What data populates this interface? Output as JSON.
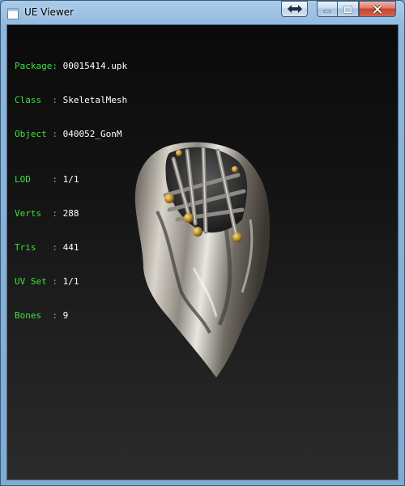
{
  "window": {
    "title": "UE Viewer",
    "icon": "app-window-icon",
    "caption_buttons": [
      "swap-arrows-icon",
      "minimize-icon",
      "maximize-icon",
      "close-icon"
    ]
  },
  "info": {
    "package": {
      "key": "Package",
      "sep": ":",
      "value": "00015414.upk"
    },
    "class": {
      "key": "Class  ",
      "sep": ":",
      "value": "SkeletalMesh"
    },
    "object": {
      "key": "Object ",
      "sep": ":",
      "value": "040052_GonM"
    },
    "lod": {
      "key": "LOD    ",
      "sep": ":",
      "value": "1/1"
    },
    "verts": {
      "key": "Verts  ",
      "sep": ":",
      "value": "288"
    },
    "tris": {
      "key": "Tris   ",
      "sep": ":",
      "value": "441"
    },
    "uvset": {
      "key": "UV Set ",
      "sep": ":",
      "value": "1/1"
    },
    "bones": {
      "key": "Bones  ",
      "sep": ":",
      "value": "9"
    }
  },
  "colors": {
    "label": "#3ce23c",
    "value": "#ffffff",
    "background": "#111111"
  }
}
